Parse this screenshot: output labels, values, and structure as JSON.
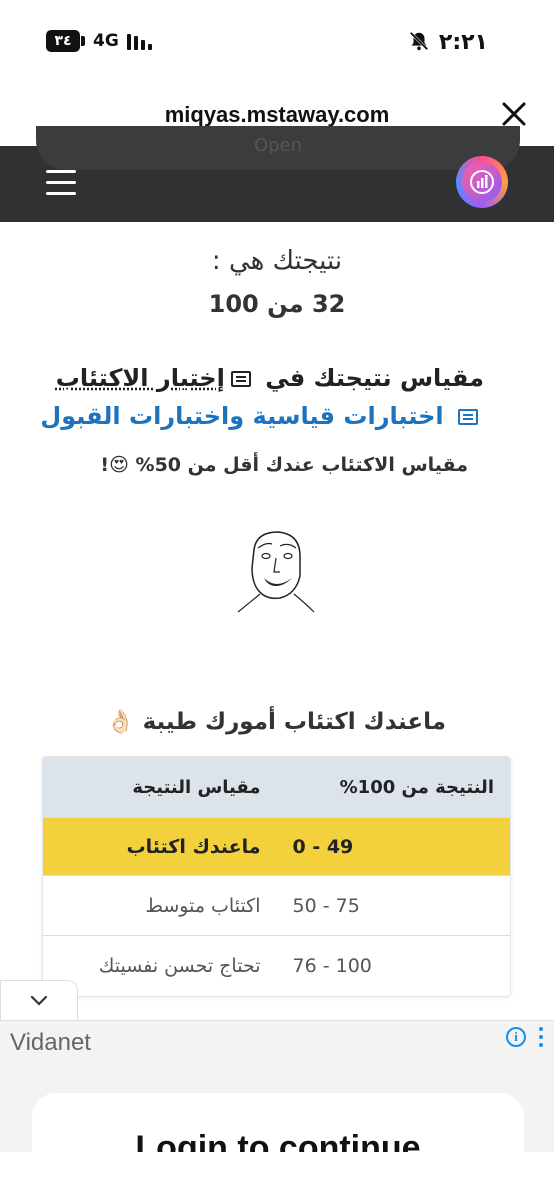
{
  "status_bar": {
    "time": "٢:٢١",
    "battery": "٣٤",
    "network": "4G"
  },
  "browser": {
    "url": "miqyas.mstaway.com",
    "open_label": "Open"
  },
  "result": {
    "label": "نتيجتك هي :",
    "score": "32 من 100"
  },
  "measure": {
    "prefix": "مقياس نتيجتك في",
    "test_name": "إختيار الاكتئاب",
    "link_text": "اختبارات قياسية واختبارات القبول",
    "less_than": "مقياس الاكتئاب عندك أقل من 50%",
    "less_than_emoji": "😍!"
  },
  "section": {
    "title": "ماعندك اكتئاب أمورك طيبة",
    "emoji": "👌🏻"
  },
  "table": {
    "headers": [
      "النتيجة من 100%",
      "مقياس النتيجة"
    ],
    "rows": [
      [
        "0 - 49",
        "ماعندك اكتئاب"
      ],
      [
        "50 - 75",
        "اكتئاب متوسط"
      ],
      [
        "76 - 100",
        "تحتاج تحسن نفسيتك"
      ]
    ],
    "highlight_color": "#f2d13c"
  },
  "ad": {
    "brand": "Vidanet",
    "info": "i",
    "cta": "Login to continue"
  },
  "colors": {
    "header_bg": "#2f3133",
    "link": "#1e73be"
  }
}
